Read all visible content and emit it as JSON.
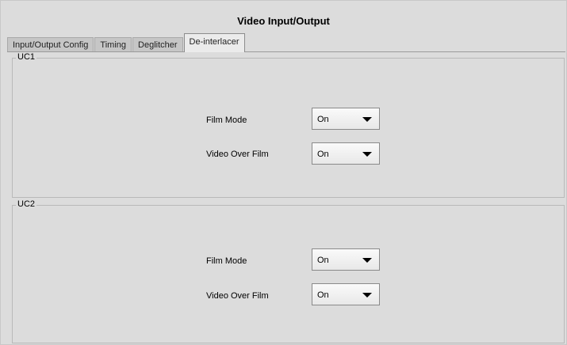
{
  "title": "Video Input/Output",
  "tabs": [
    {
      "label": "Input/Output Config"
    },
    {
      "label": "Timing"
    },
    {
      "label": "Deglitcher"
    },
    {
      "label": "De-interlacer"
    }
  ],
  "groups": [
    {
      "label": "UC1",
      "rows": [
        {
          "label": "Film Mode",
          "value": "On"
        },
        {
          "label": "Video Over Film",
          "value": "On"
        }
      ]
    },
    {
      "label": "UC2",
      "rows": [
        {
          "label": "Film Mode",
          "value": "On"
        },
        {
          "label": "Video Over Film",
          "value": "On"
        }
      ]
    }
  ],
  "icons": {
    "dropdown": "triangle-down-icon"
  }
}
